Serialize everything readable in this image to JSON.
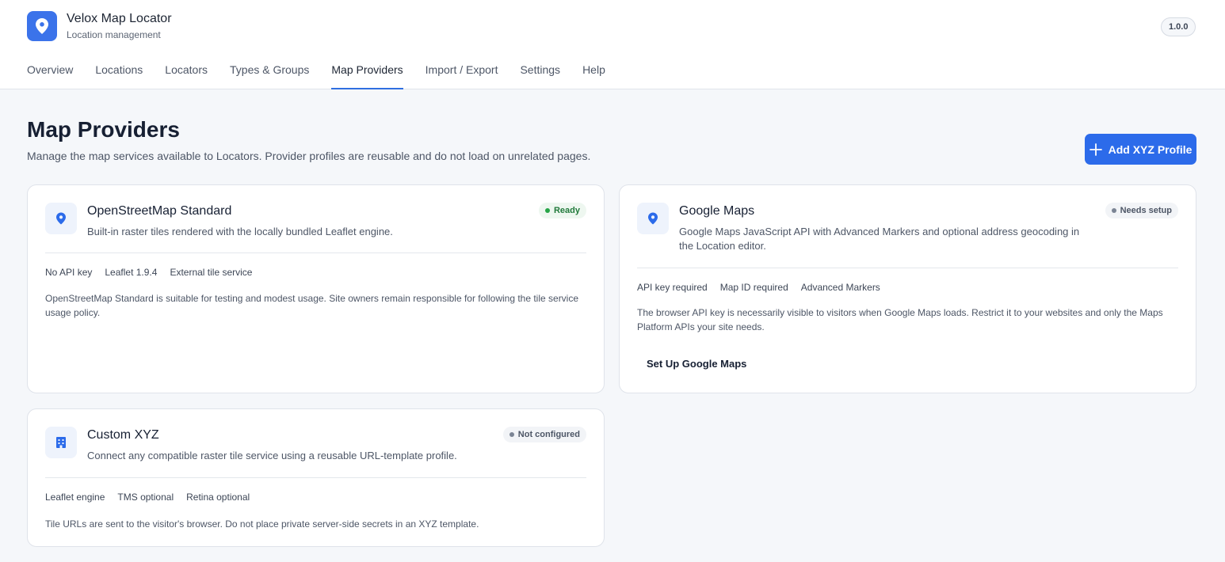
{
  "app": {
    "title": "Velox Map Locator",
    "subtitle": "Location management",
    "version": "1.0.0",
    "logo_icon": "map-pin-icon",
    "accent_color": "#2c6bea"
  },
  "nav": {
    "tabs": [
      {
        "label": "Overview",
        "active": false
      },
      {
        "label": "Locations",
        "active": false
      },
      {
        "label": "Locators",
        "active": false
      },
      {
        "label": "Types & Groups",
        "active": false
      },
      {
        "label": "Map Providers",
        "active": true
      },
      {
        "label": "Import / Export",
        "active": false
      },
      {
        "label": "Settings",
        "active": false
      },
      {
        "label": "Help",
        "active": false
      }
    ]
  },
  "page": {
    "title": "Map Providers",
    "description": "Manage the map services available to Locators. Provider profiles are reusable and do not load on unrelated pages.",
    "add_button_label": "Add XYZ Profile",
    "add_button_icon": "plus-icon"
  },
  "providers": {
    "osm": {
      "icon": "map-pin-icon",
      "title": "OpenStreetMap Standard",
      "status": "Ready",
      "status_color": "#26a447",
      "description": "Built-in raster tiles rendered with the locally bundled Leaflet engine.",
      "tags": [
        "No API key",
        "Leaflet 1.9.4",
        "External tile service"
      ],
      "note": "OpenStreetMap Standard is suitable for testing and modest usage. Site owners remain responsible for following the tile service usage policy."
    },
    "google": {
      "icon": "map-pin-icon",
      "title": "Google Maps",
      "status": "Needs setup",
      "status_color": "#7b8494",
      "description": "Google Maps JavaScript API with Advanced Markers and optional address geocoding in the Location editor.",
      "tags": [
        "API key required",
        "Map ID required",
        "Advanced Markers"
      ],
      "note": "The browser API key is necessarily visible to visitors when Google Maps loads. Restrict it to your websites and only the Maps Platform APIs your site needs.",
      "action_label": "Set Up Google Maps"
    },
    "xyz": {
      "icon": "building-icon",
      "title": "Custom XYZ",
      "status": "Not configured",
      "status_color": "#7b8494",
      "description": "Connect any compatible raster tile service using a reusable URL-template profile.",
      "tags": [
        "Leaflet engine",
        "TMS optional",
        "Retina optional"
      ],
      "note": "Tile URLs are sent to the visitor's browser. Do not place private server-side secrets in an XYZ template."
    }
  }
}
